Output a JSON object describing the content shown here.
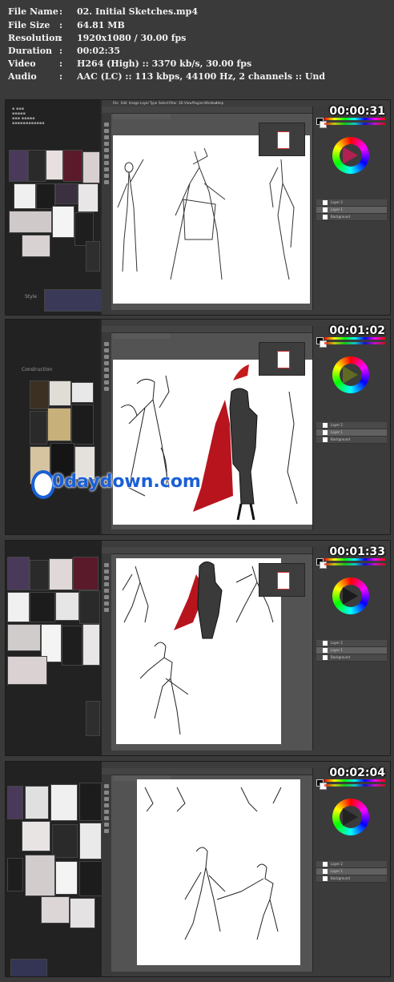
{
  "info": [
    {
      "key": "File Name",
      "value": "02. Initial Sketches.mp4"
    },
    {
      "key": "File Size",
      "value": "64.81 MB"
    },
    {
      "key": "Resolution",
      "value": "1920x1080 / 30.00 fps"
    },
    {
      "key": "Duration",
      "value": "00:02:35"
    },
    {
      "key": "Video",
      "value": "H264 (High) :: 3370 kb/s, 30.00 fps"
    },
    {
      "key": "Audio",
      "value": "AAC (LC) :: 113 kbps, 44100 Hz, 2 channels :: Und"
    }
  ],
  "colon": ":",
  "frames": [
    {
      "timestamp": "00:00:31"
    },
    {
      "timestamp": "00:01:02"
    },
    {
      "timestamp": "00:01:33"
    },
    {
      "timestamp": "00:02:04"
    }
  ],
  "ref_labels": {
    "frame1_label": "Style",
    "frame2_label": "Construction"
  },
  "watermark": "0daydown.com",
  "ps_menu": [
    "File",
    "Edit",
    "Image",
    "Layer",
    "Type",
    "Select",
    "Filter",
    "3D",
    "View",
    "Plugins",
    "Window",
    "Help"
  ],
  "layers": [
    "Layer 2",
    "Layer 1",
    "Background"
  ],
  "colors": {
    "background": "#3a3a3a",
    "info_text": "#f2f2f2",
    "timestamp": "#ffffff",
    "watermark": "#1a5fd6",
    "cape_red": "#b8141e"
  },
  "icons": [
    "color-wheel-icon",
    "navigator-thumbnail",
    "tool-icon"
  ]
}
